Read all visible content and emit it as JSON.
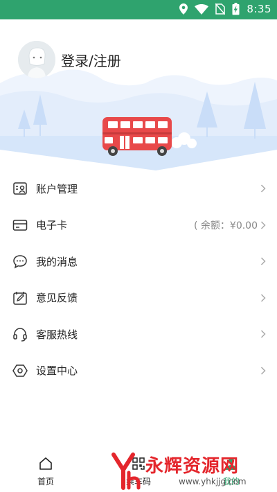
{
  "status_bar": {
    "time": "8:35",
    "icons": [
      "location-icon",
      "wifi-icon",
      "no-sim-icon",
      "battery-charging-icon"
    ]
  },
  "header": {
    "login_label": "登录/注册"
  },
  "menu": {
    "items": [
      {
        "label": "账户管理",
        "icon": "account-card-icon"
      },
      {
        "label": "电子卡",
        "icon": "e-card-icon",
        "value": "( 余额：¥0.00"
      },
      {
        "label": "我的消息",
        "icon": "message-bubble-icon"
      },
      {
        "label": "意见反馈",
        "icon": "feedback-edit-icon"
      },
      {
        "label": "客服热线",
        "icon": "headset-icon"
      },
      {
        "label": "设置中心",
        "icon": "settings-hexagon-icon"
      }
    ]
  },
  "tabbar": {
    "tabs": [
      {
        "label": "首页",
        "icon": "home-icon"
      },
      {
        "label": "乘车码",
        "icon": "qr-code-icon"
      },
      {
        "label": "我的",
        "icon": "person-icon"
      }
    ]
  },
  "watermark": {
    "brand": "永辉资源网",
    "url": "www.yhkjjg.com"
  },
  "colors": {
    "accent": "#2fa36e",
    "bus_red": "#e8494a",
    "scene_blue": "#dbe9fb"
  }
}
